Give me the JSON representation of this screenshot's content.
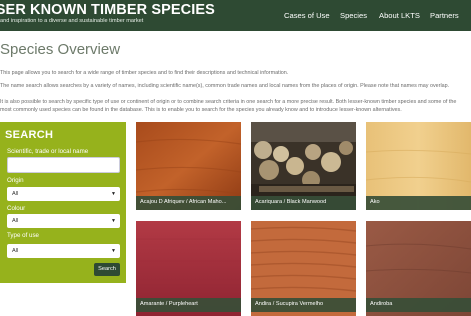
{
  "header": {
    "title": "SSER KNOWN TIMBER SPECIES",
    "tagline": "and inspiration to a diverse and sustainable timber market",
    "nav": [
      "Cases of Use",
      "Species",
      "About LKTS",
      "Partners"
    ]
  },
  "page": {
    "title": "Species Overview",
    "intro_1": "This page allows you to search for a wide range of timber species and to find their descriptions and technical information.",
    "intro_2": "The name search allows searches by a variety of names, including scientific name(s), common trade names and local names from the places of origin. Please note that names may overlap.",
    "intro_3": "It is also possible to search by specific type of use or continent of origin or to combine search criteria in one search for a more precise result. Both lesser-known timber species and some of the most commonly used species can be found in the database. This is to enable you to search for the species you already know and to introduce lesser-known alternatives."
  },
  "search": {
    "title": "SEARCH",
    "name_label": "Scientific, trade or local name",
    "name_value": "",
    "origin_label": "Origin",
    "origin_value": "All",
    "colour_label": "Colour",
    "colour_value": "All",
    "use_label": "Type of use",
    "use_value": "All",
    "button_label": "Search"
  },
  "species": [
    {
      "name": "Acajou D Afriquev / African Maho..."
    },
    {
      "name": "Acariquara / Black Manwood"
    },
    {
      "name": "Ako"
    },
    {
      "name": "Amarante / Purpleheart"
    },
    {
      "name": "Andira / Sucupira Vermelho"
    },
    {
      "name": "Andiroba"
    }
  ],
  "colors": {
    "header_bg": "#2e4a33",
    "search_panel_bg": "#96b21c",
    "caption_bg": "#374e37"
  }
}
